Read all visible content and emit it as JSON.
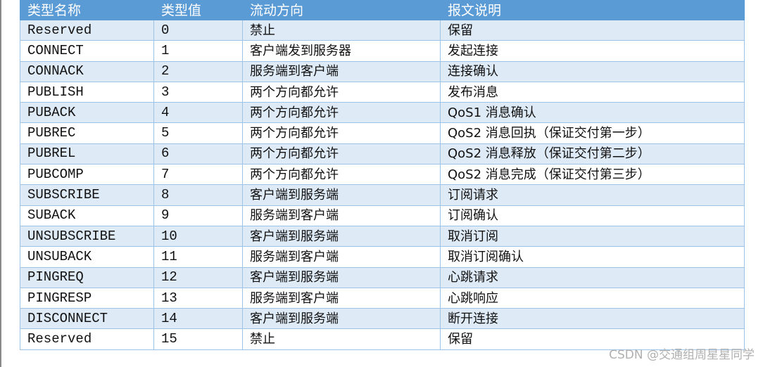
{
  "table": {
    "headers": [
      "类型名称",
      "类型值",
      "流动方向",
      "报文说明"
    ],
    "rows": [
      {
        "name": "Reserved",
        "value": "0",
        "direction": "禁止",
        "description": "保留"
      },
      {
        "name": "CONNECT",
        "value": "1",
        "direction": "客户端发到服务器",
        "description": "发起连接"
      },
      {
        "name": "CONNACK",
        "value": "2",
        "direction": "服务端到客户端",
        "description": "连接确认"
      },
      {
        "name": "PUBLISH",
        "value": "3",
        "direction": "两个方向都允许",
        "description": "发布消息"
      },
      {
        "name": "PUBACK",
        "value": "4",
        "direction": "两个方向都允许",
        "description": "QoS1 消息确认"
      },
      {
        "name": "PUBREC",
        "value": "5",
        "direction": "两个方向都允许",
        "description": "QoS2 消息回执（保证交付第一步）"
      },
      {
        "name": "PUBREL",
        "value": "6",
        "direction": "两个方向都允许",
        "description": "QoS2 消息释放（保证交付第二步）"
      },
      {
        "name": "PUBCOMP",
        "value": "7",
        "direction": "两个方向都允许",
        "description": "QoS2 消息完成（保证交付第三步）"
      },
      {
        "name": "SUBSCRIBE",
        "value": "8",
        "direction": "客户端到服务端",
        "description": "订阅请求"
      },
      {
        "name": "SUBACK",
        "value": "9",
        "direction": "服务端到客户端",
        "description": "订阅确认"
      },
      {
        "name": "UNSUBSCRIBE",
        "value": "10",
        "direction": "客户端到服务端",
        "description": "取消订阅"
      },
      {
        "name": "UNSUBACK",
        "value": "11",
        "direction": "服务端到客户端",
        "description": "取消订阅确认"
      },
      {
        "name": "PINGREQ",
        "value": "12",
        "direction": "客户端到服务端",
        "description": "心跳请求"
      },
      {
        "name": "PINGRESP",
        "value": "13",
        "direction": "服务端到客户端",
        "description": "心跳响应"
      },
      {
        "name": "DISCONNECT",
        "value": "14",
        "direction": "客户端到服务端",
        "description": "断开连接"
      },
      {
        "name": "Reserved",
        "value": "15",
        "direction": "禁止",
        "description": "保留"
      }
    ]
  },
  "watermark": "CSDN @交通组周星星同学",
  "colors": {
    "header_bg": "#5b9bd5",
    "row_alt_bg": "#deeaf6",
    "border": "#9dc3e6"
  }
}
